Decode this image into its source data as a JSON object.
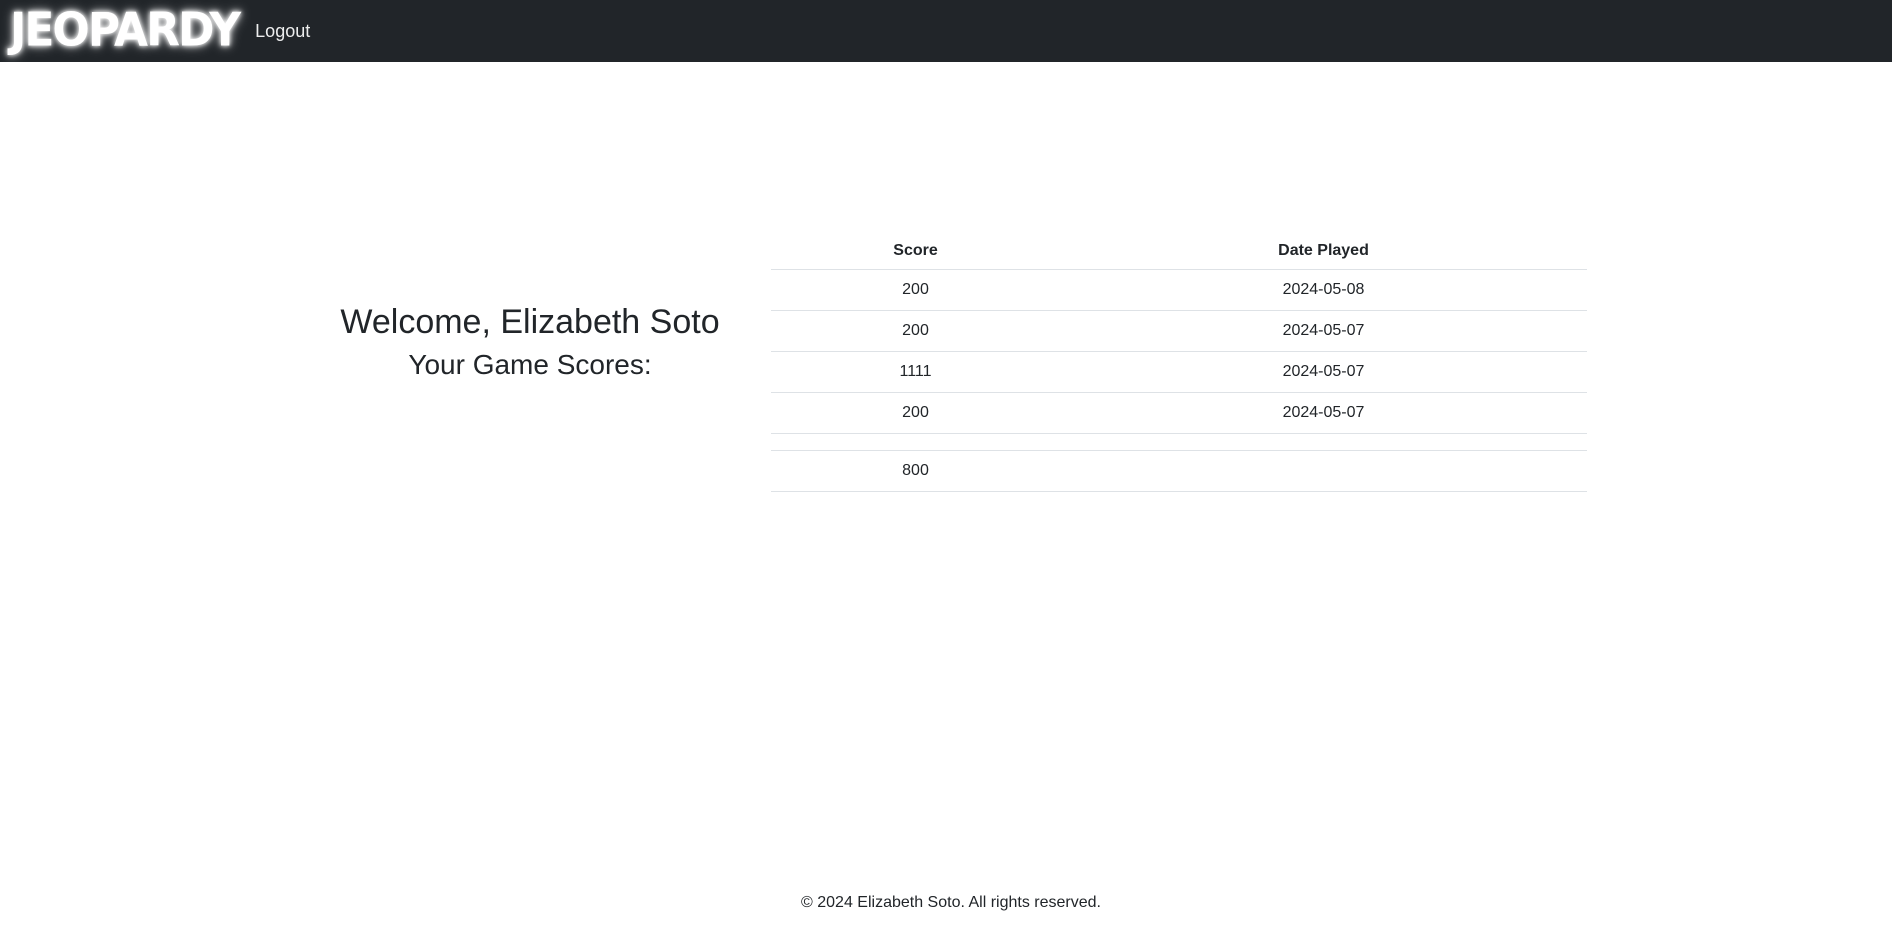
{
  "navbar": {
    "brand": "JEOPARDY",
    "logout_label": "Logout",
    "background": "#212529"
  },
  "welcome": {
    "title": "Welcome, Elizabeth Soto",
    "subtitle": "Your Game Scores:"
  },
  "scores_table": {
    "headers": {
      "score": "Score",
      "date": "Date Played"
    },
    "rows": [
      {
        "score": "200",
        "date": "2024-05-08"
      },
      {
        "score": "200",
        "date": "2024-05-07"
      },
      {
        "score": "1111",
        "date": "2024-05-07"
      },
      {
        "score": "200",
        "date": "2024-05-07"
      }
    ],
    "total": "800"
  },
  "footer": {
    "text": "© 2024 Elizabeth Soto. All rights reserved."
  }
}
